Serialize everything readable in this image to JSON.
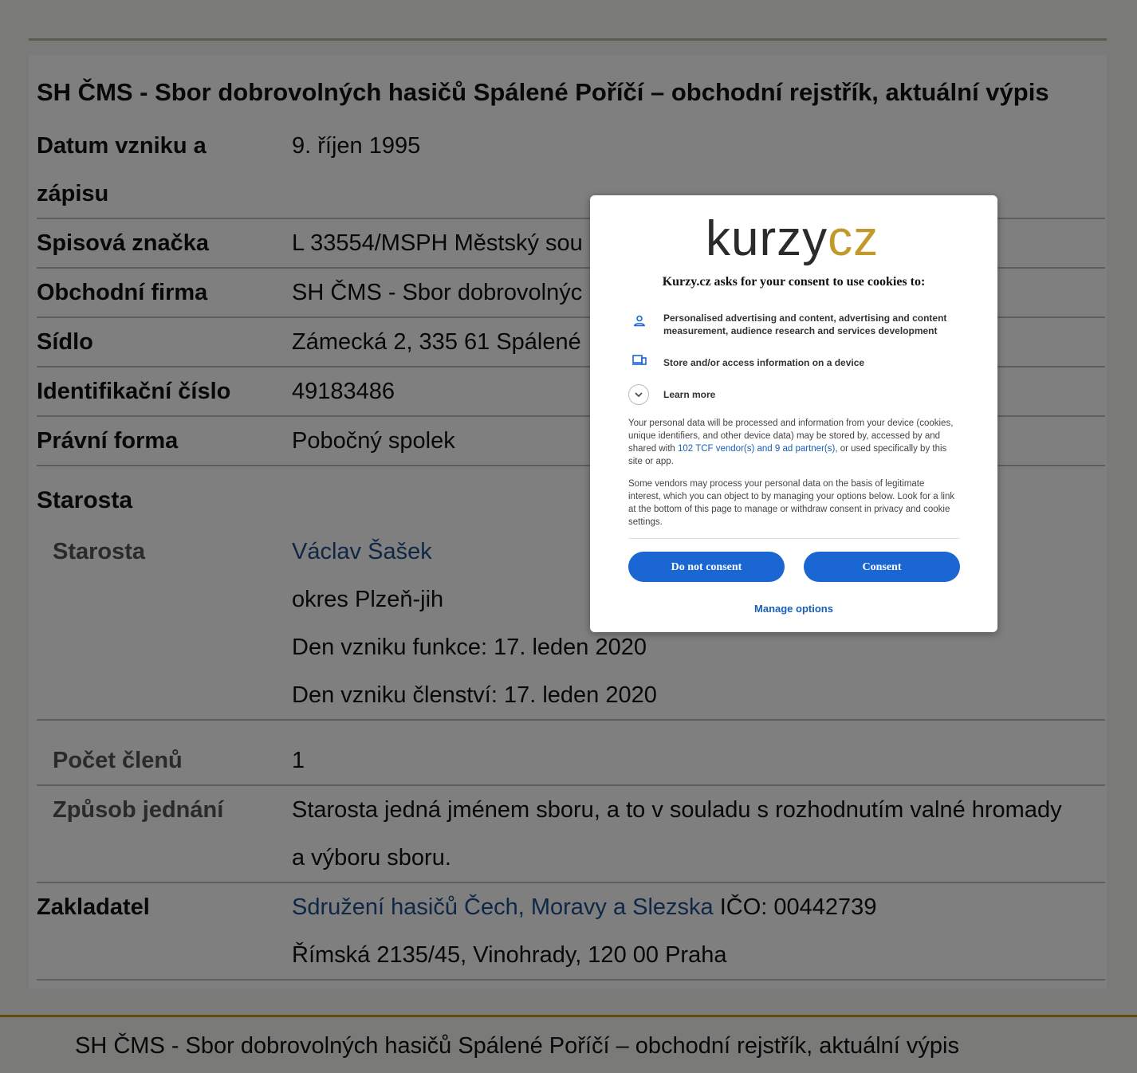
{
  "page": {
    "title": "SH ČMS - Sbor dobrovolných hasičů Spálené Poříčí – obchodní rejstřík, aktuální výpis",
    "rows": {
      "datum_label_1": "Datum vzniku a",
      "datum_label_2": "zápisu",
      "datum_value": "9. říjen 1995",
      "spis_label": "Spisová značka",
      "spis_value": "L 33554/MSPH Městský sou",
      "firma_label": "Obchodní firma",
      "firma_value": "SH ČMS - Sbor dobrovolnýc",
      "sidlo_label": "Sídlo",
      "sidlo_value": "Zámecká 2, 335 61 Spálené",
      "ico_label": "Identifikační číslo",
      "ico_value": "49183486",
      "forma_label": "Právní forma",
      "forma_value": "Pobočný spolek"
    },
    "starosta": {
      "section_title": "Starosta",
      "sub_label": "Starosta",
      "name": "Václav Šašek",
      "district": "okres Plzeň-jih",
      "function_start": "Den vzniku funkce: 17. leden 2020",
      "membership_start": "Den vzniku členství: 17. leden 2020",
      "members_label": "Počet členů",
      "members_value": "1",
      "acting_label": "Způsob jednání",
      "acting_value_1": "Starosta jedná jménem sboru, a to v souladu s rozhodnutím valné hromady",
      "acting_value_2": "a výboru sboru."
    },
    "founder": {
      "label": "Zakladatel",
      "name": "Sdružení hasičů Čech, Moravy a Slezska",
      "ico": " IČO: 00442739",
      "address": "Římská 2135/45, Vinohrady, 120 00 Praha"
    },
    "footer_title": "SH ČMS - Sbor dobrovolných hasičů Spálené Poříčí – obchodní rejstřík, aktuální výpis"
  },
  "consent": {
    "logo_part1": "kurzy",
    "logo_part2": "cz",
    "heading": "Kurzy.cz asks for your consent to use cookies to:",
    "purpose_1": "Personalised advertising and content, advertising and content measurement, audience research and services development",
    "purpose_2": "Store and/or access information on a device",
    "learn_more": "Learn more",
    "para1_a": "Your personal data will be processed and information from your device (cookies, unique identifiers, and other device data) may be stored by, accessed by and shared with ",
    "para1_link": "102 TCF vendor(s) and 9 ad partner(s)",
    "para1_b": ", or used specifically by this site or app.",
    "para2": "Some vendors may process your personal data on the basis of legitimate interest, which you can object to by managing your options below. Look for a link at the bottom of this page to manage or withdraw consent in privacy and cookie settings.",
    "do_not_consent": "Do not consent",
    "consent": "Consent",
    "manage_options": "Manage options",
    "accent_color": "#1a66d2",
    "logo_gold": "#c19a2a"
  }
}
